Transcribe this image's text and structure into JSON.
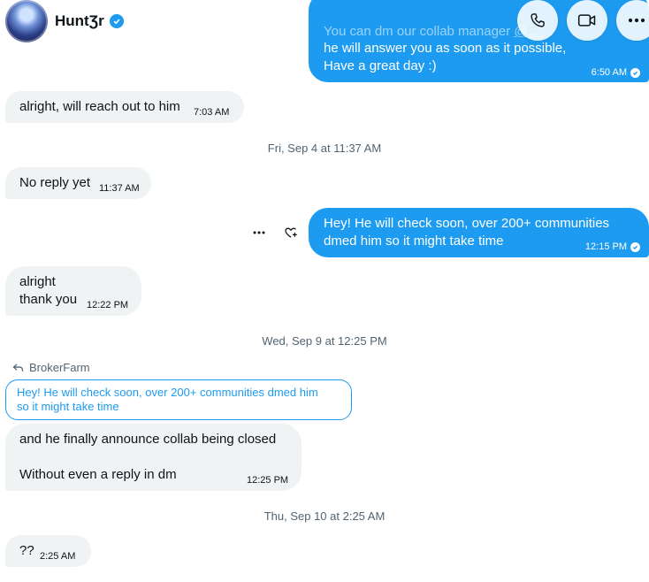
{
  "header": {
    "name": "HuntƷr",
    "verified": true,
    "actions": [
      "phone-icon",
      "video-icon",
      "more-icon"
    ]
  },
  "colors": {
    "outgoing": "#1d9bf0",
    "incoming": "#eff3f4",
    "muted": "#536471"
  },
  "messages": {
    "m1": {
      "line0": "You can dm our collab manager",
      "line0b": "@....",
      "line1": "he will answer you as soon as it possible,",
      "line2": "Have a great day :)",
      "time": "6:50 AM"
    },
    "m2": {
      "text": "alright, will reach out to him",
      "time": "7:03 AM"
    },
    "d1": "Fri, Sep 4 at 11:37 AM",
    "m3": {
      "text": "No reply yet",
      "time": "11:37 AM"
    },
    "m4": {
      "line1": "Hey! He will check soon, over 200+ communities",
      "line2": "dmed him so it might take time",
      "time": "12:15 PM"
    },
    "m5": {
      "line1": "alright",
      "line2": "thank you",
      "time": "12:22 PM"
    },
    "d2": "Wed, Sep 9 at 12:25 PM",
    "reply": {
      "replying_to": "BrokerFarm",
      "quote_line1": "Hey! He will check soon, over 200+ communities dmed him",
      "quote_line2": "so it might take time"
    },
    "m6": {
      "line1": "and he finally announce collab being closed",
      "line2": "Without even a reply in dm",
      "time": "12:25 PM"
    },
    "d3": "Thu, Sep 10 at 2:25 AM",
    "m7": {
      "text": "??",
      "time": "2:25 AM"
    }
  }
}
